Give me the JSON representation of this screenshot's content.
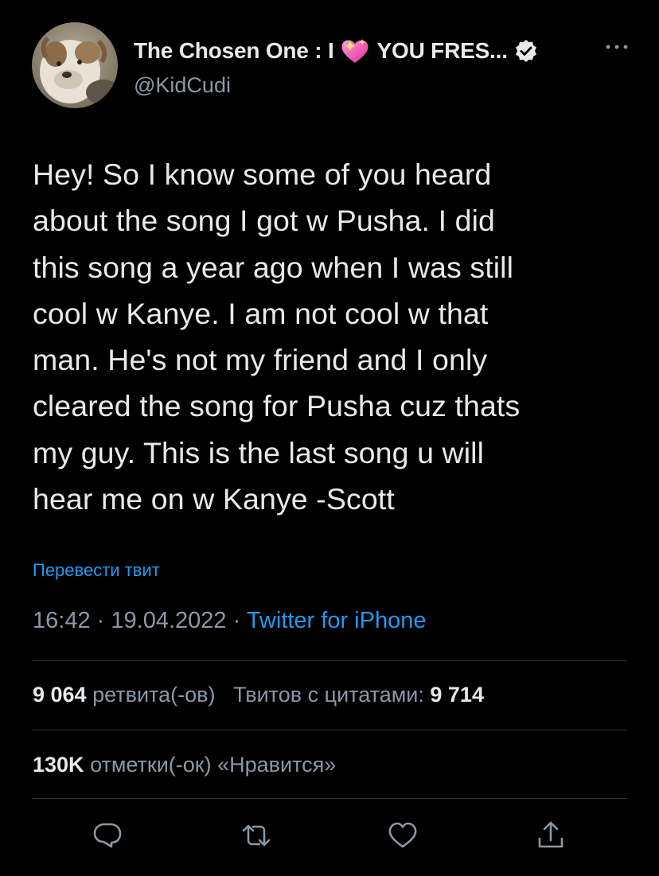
{
  "author": {
    "display_name_prefix": "The Chosen One : I",
    "display_name_suffix": "YOU FRES...",
    "handle": "@KidCudi",
    "heart_icon": "sparkling-heart-icon",
    "verified_icon": "verified-badge-icon"
  },
  "tweet": {
    "text": "Hey! So I know some of you heard\nabout the song I got w Pusha. I did\nthis song a year ago when I was still\ncool w Kanye.  I am not cool w that\nman.  He's not my friend and I only\ncleared the song for Pusha cuz thats\nmy guy. This is the last song u will\nhear me on w Kanye -Scott",
    "translate_label": "Перевести твит",
    "time": "16:42",
    "separator": "·",
    "date": "19.04.2022",
    "source": "Twitter for iPhone"
  },
  "stats": {
    "retweets_count": "9 064",
    "retweets_label": "ретвита(-ов)",
    "quotes_label": "Твитов с цитатами:",
    "quotes_count": "9 714",
    "likes_count": "130K",
    "likes_label": "отметки(-ок) «Нравится»"
  },
  "actions": {
    "reply_icon": "reply-icon",
    "retweet_icon": "retweet-icon",
    "like_icon": "heart-outline-icon",
    "share_icon": "share-icon"
  },
  "colors": {
    "background": "#000000",
    "text_primary": "#e7e9ea",
    "text_secondary": "#8b98a5",
    "accent": "#1d9bf0",
    "divider": "#2f3336"
  }
}
